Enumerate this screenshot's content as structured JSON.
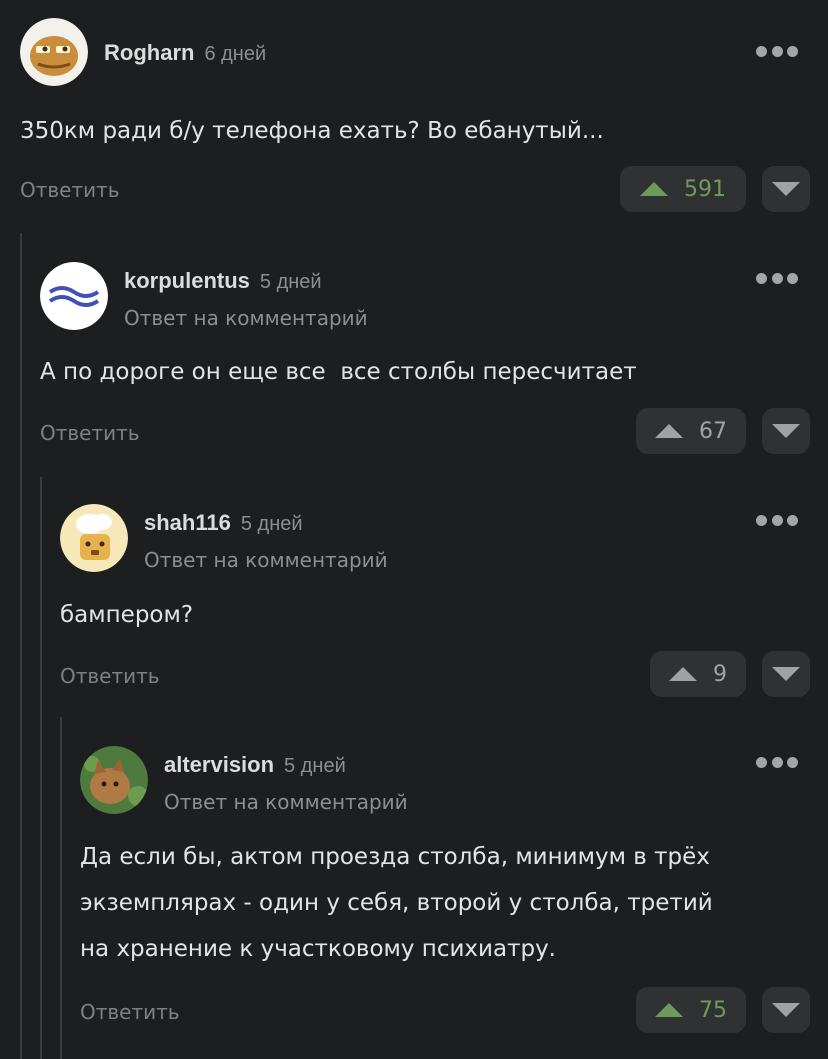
{
  "comments": [
    {
      "author": "Rogharn",
      "time": "6 дней",
      "subtitle": "",
      "text": "350км ради б/у телефона ехать? Во ебанутый...",
      "reply_label": "Ответить",
      "rating": "591",
      "avatar_icon": "pepe-avatar-icon"
    },
    {
      "author": "korpulentus",
      "time": "5 дней",
      "subtitle": "Ответ на комментарий",
      "text": "А по дороге он еще все  все столбы пересчитает",
      "reply_label": "Ответить",
      "rating": "67",
      "avatar_icon": "wave-avatar-icon"
    },
    {
      "author": "shah116",
      "time": "5 дней",
      "subtitle": "Ответ на комментарий",
      "text": "бампером?",
      "reply_label": "Ответить",
      "rating": "9",
      "avatar_icon": "chef-avatar-icon"
    },
    {
      "author": "altervision",
      "time": "5 дней",
      "subtitle": "Ответ на комментарий",
      "text": "Да если бы, актом проезда столба, минимум в трёх\nэкземплярах - один у себя, второй у столба, третий\nна хранение к участковому психиатру.",
      "reply_label": "Ответить",
      "rating": "75",
      "avatar_icon": "cat-avatar-icon"
    }
  ],
  "colors": {
    "background": "#1d1e20",
    "positive_rating": "#6e9b5b",
    "neutral_rating": "#a1a2a5",
    "muted_text": "#8d8e91"
  }
}
